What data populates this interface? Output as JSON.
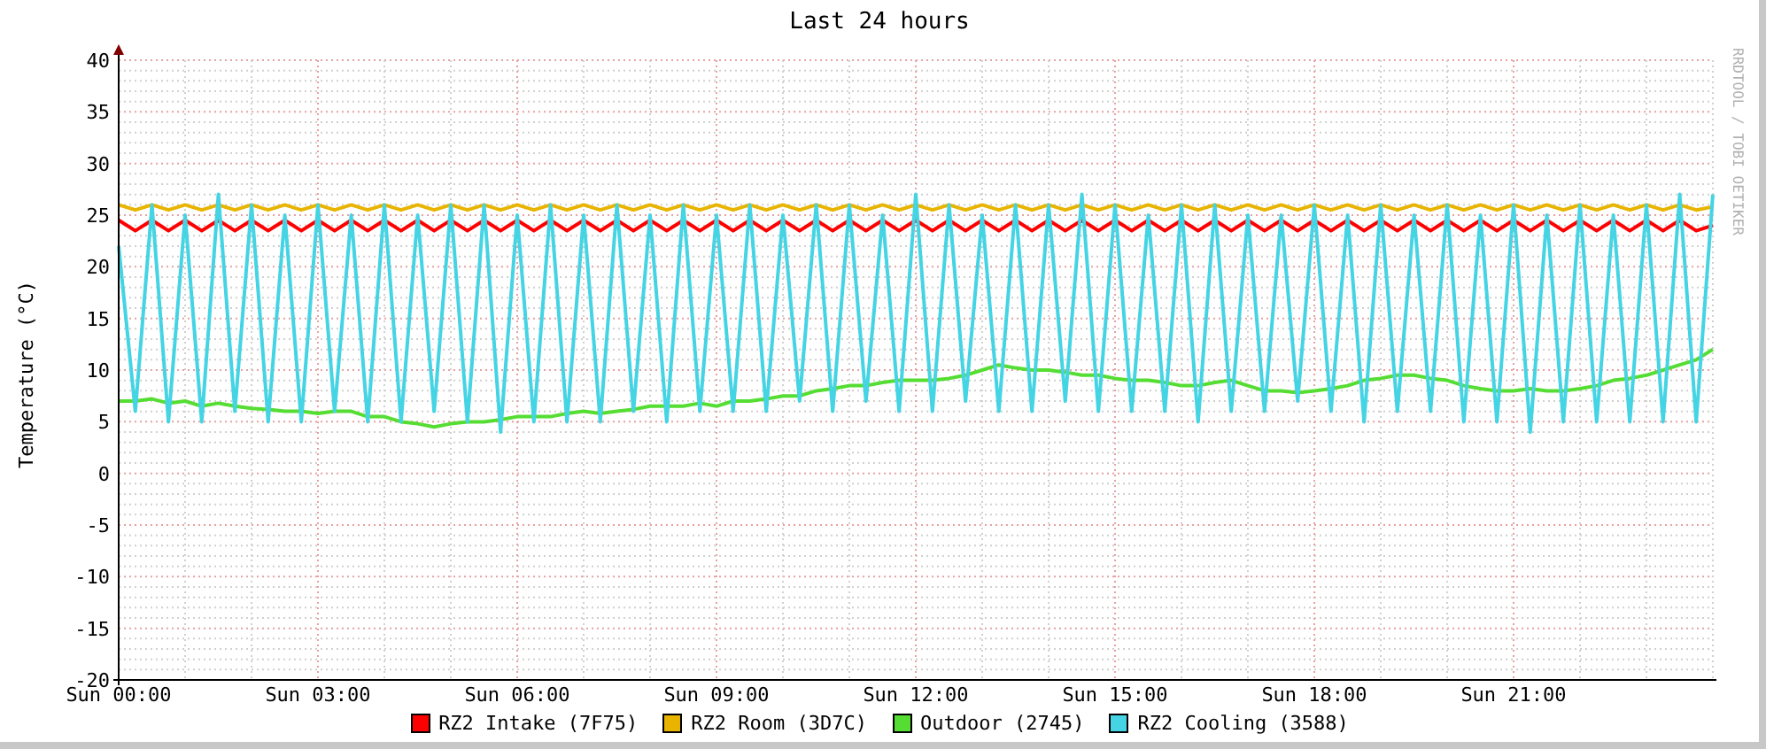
{
  "credit": {
    "text": "RRDTOOL / TOBI OETIKER"
  },
  "chart_data": {
    "type": "line",
    "grid": true,
    "title": "Last 24 hours",
    "ylabel": "Temperature (°C)",
    "ylim": [
      -20,
      40
    ],
    "yticks": [
      -20,
      -15,
      -10,
      -5,
      0,
      5,
      10,
      15,
      20,
      25,
      30,
      35,
      40
    ],
    "categories": [
      "Sun 00:00",
      null,
      null,
      null,
      null,
      null,
      null,
      null,
      null,
      null,
      null,
      null,
      "Sun 03:00",
      null,
      null,
      null,
      null,
      null,
      null,
      null,
      null,
      null,
      null,
      null,
      "Sun 06:00",
      null,
      null,
      null,
      null,
      null,
      null,
      null,
      null,
      null,
      null,
      null,
      "Sun 09:00",
      null,
      null,
      null,
      null,
      null,
      null,
      null,
      null,
      null,
      null,
      null,
      "Sun 12:00",
      null,
      null,
      null,
      null,
      null,
      null,
      null,
      null,
      null,
      null,
      null,
      "Sun 15:00",
      null,
      null,
      null,
      null,
      null,
      null,
      null,
      null,
      null,
      null,
      null,
      "Sun 18:00",
      null,
      null,
      null,
      null,
      null,
      null,
      null,
      null,
      null,
      null,
      null,
      "Sun 21:00",
      null,
      null,
      null,
      null,
      null,
      null,
      null,
      null,
      null,
      null,
      null,
      null
    ],
    "series": [
      {
        "name": "RZ2 Intake (7F75)",
        "color": "#ff0000",
        "values": [
          24.5,
          23.5,
          24.5,
          23.5,
          24.5,
          23.5,
          24.5,
          23.5,
          24.5,
          23.5,
          24.5,
          23.5,
          24.5,
          23.5,
          24.5,
          23.5,
          24.5,
          23.5,
          24.5,
          23.5,
          24.5,
          23.5,
          24.5,
          23.5,
          24.5,
          23.5,
          24.5,
          23.5,
          24.5,
          23.5,
          24.5,
          23.5,
          24.5,
          23.5,
          24.5,
          23.5,
          24.5,
          23.5,
          24.5,
          23.5,
          24.5,
          23.5,
          24.5,
          23.5,
          24.5,
          23.5,
          24.5,
          23.5,
          24.5,
          23.5,
          24.5,
          23.5,
          24.5,
          23.5,
          24.5,
          23.5,
          24.5,
          23.5,
          24.5,
          23.5,
          24.5,
          23.5,
          24.5,
          23.5,
          24.5,
          23.5,
          24.5,
          23.5,
          24.5,
          23.5,
          24.5,
          23.5,
          24.5,
          23.5,
          24.5,
          23.5,
          24.5,
          23.5,
          24.5,
          23.5,
          24.5,
          23.5,
          24.5,
          23.5,
          24.5,
          23.5,
          24.5,
          23.5,
          24.5,
          23.5,
          24.5,
          23.5,
          24.5,
          23.5,
          24.5,
          23.5,
          24
        ]
      },
      {
        "name": "RZ2 Room (3D7C)",
        "color": "#e8b400",
        "values": [
          26,
          25.5,
          26,
          25.5,
          26,
          25.5,
          26,
          25.5,
          26,
          25.5,
          26,
          25.5,
          26,
          25.5,
          26,
          25.5,
          26,
          25.5,
          26,
          25.5,
          26,
          25.5,
          26,
          25.5,
          26,
          25.5,
          26,
          25.5,
          26,
          25.5,
          26,
          25.5,
          26,
          25.5,
          26,
          25.5,
          26,
          25.5,
          26,
          25.5,
          26,
          25.5,
          26,
          25.5,
          26,
          25.5,
          26,
          25.5,
          26,
          25.5,
          26,
          25.5,
          26,
          25.5,
          26,
          25.5,
          26,
          25.5,
          26,
          25.5,
          26,
          25.5,
          26,
          25.5,
          26,
          25.5,
          26,
          25.5,
          26,
          25.5,
          26,
          25.5,
          26,
          25.5,
          26,
          25.5,
          26,
          25.5,
          26,
          25.5,
          26,
          25.5,
          26,
          25.5,
          26,
          25.5,
          26,
          25.5,
          26,
          25.5,
          26,
          25.5,
          26,
          25.5,
          26,
          25.5,
          25.8
        ]
      },
      {
        "name": "Outdoor (2745)",
        "color": "#55dd33",
        "values": [
          7,
          7,
          7.2,
          6.8,
          7,
          6.5,
          6.8,
          6.5,
          6.3,
          6.2,
          6,
          6,
          5.8,
          6,
          6,
          5.5,
          5.5,
          5,
          4.8,
          4.5,
          4.8,
          5,
          5,
          5.2,
          5.5,
          5.5,
          5.5,
          5.8,
          6,
          5.8,
          6,
          6.2,
          6.5,
          6.5,
          6.5,
          6.8,
          6.5,
          7,
          7,
          7.2,
          7.5,
          7.5,
          8,
          8.2,
          8.5,
          8.5,
          8.8,
          9,
          9,
          9,
          9.2,
          9.5,
          10,
          10.5,
          10.2,
          10,
          10,
          9.8,
          9.5,
          9.5,
          9.2,
          9,
          9,
          8.8,
          8.5,
          8.5,
          8.8,
          9,
          8.5,
          8,
          8,
          7.8,
          8,
          8.2,
          8.5,
          9,
          9.2,
          9.5,
          9.5,
          9.2,
          9,
          8.5,
          8.2,
          8,
          8,
          8.2,
          8,
          8,
          8.2,
          8.5,
          9,
          9.2,
          9.5,
          10,
          10.5,
          11,
          12
        ]
      },
      {
        "name": "RZ2 Cooling (3588)",
        "color": "#44d4e4",
        "values": [
          22,
          6,
          26,
          5,
          25,
          5,
          27,
          6,
          26,
          5,
          25,
          5,
          26,
          6,
          25,
          5,
          26,
          5,
          25,
          6,
          26,
          5,
          26,
          4,
          25,
          5,
          26,
          5,
          25,
          5,
          26,
          6,
          25,
          5,
          26,
          6,
          25,
          6,
          26,
          6,
          25,
          7,
          26,
          6,
          26,
          7,
          25,
          6,
          27,
          6,
          26,
          7,
          25,
          6,
          26,
          6,
          26,
          7,
          27,
          6,
          26,
          6,
          25,
          6,
          26,
          5,
          26,
          6,
          25,
          6,
          25,
          7,
          26,
          6,
          25,
          5,
          26,
          6,
          25,
          6,
          26,
          5,
          25,
          5,
          26,
          4,
          25,
          5,
          26,
          5,
          25,
          5,
          26,
          5,
          27,
          5,
          27
        ]
      }
    ]
  }
}
